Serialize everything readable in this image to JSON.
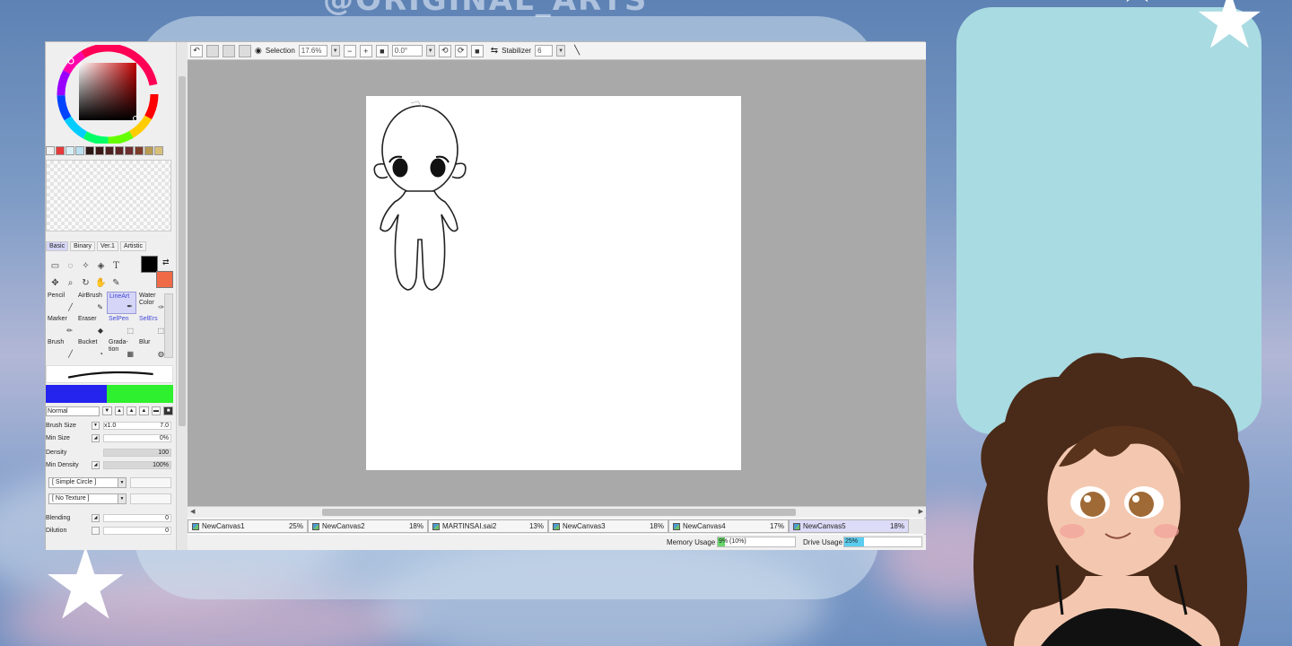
{
  "watermark": "@ORIGINAL_ARTS",
  "colors": {
    "fg": "#000000",
    "bg": "#ef6a47",
    "accent_tab": "#dcdcf8",
    "panel_cyan": "#a9dbe2",
    "memory_bar": "#69d66c",
    "drive_bar": "#5ccdf0"
  },
  "toolbar": {
    "undo_icon": "undo-icon",
    "selection_label": "Selection",
    "zoom_value": "17.6%",
    "rotation_value": "0.0°",
    "stabilizer_label": "Stabilizer",
    "stabilizer_value": "6"
  },
  "palette": [
    "#f2f2f2",
    "#e63939",
    "#d7f0f7",
    "#b9dff0",
    "#2b1616",
    "#3a1818",
    "#4a2020",
    "#5b2626",
    "#6d2f2f",
    "#7d3b2a",
    "#b89a52",
    "#d8c07a"
  ],
  "toolset_tabs": [
    "Basic",
    "Binary",
    "Ver.1",
    "Artistic"
  ],
  "brushes": [
    {
      "label": "Pencil",
      "active": false,
      "blue": false
    },
    {
      "label": "AirBrush",
      "active": false,
      "blue": false
    },
    {
      "label": "LineArt",
      "active": true,
      "blue": true
    },
    {
      "label": "Water Color",
      "active": false,
      "blue": false
    },
    {
      "label": "Marker",
      "active": false,
      "blue": false
    },
    {
      "label": "Eraser",
      "active": false,
      "blue": false
    },
    {
      "label": "SelPen",
      "active": false,
      "blue": true
    },
    {
      "label": "SelErs",
      "active": false,
      "blue": true
    },
    {
      "label": "Brush",
      "active": false,
      "blue": false
    },
    {
      "label": "Bucket",
      "active": false,
      "blue": false
    },
    {
      "label": "Grada-tion",
      "active": false,
      "blue": false
    },
    {
      "label": "Blur",
      "active": false,
      "blue": false
    }
  ],
  "brush_settings": {
    "mode": "Normal",
    "brush_size_label": "Brush Size",
    "brush_size_mult": "x1.0",
    "brush_size_value": "7.0",
    "min_size_label": "Min Size",
    "min_size_value": "0%",
    "density_label": "Density",
    "density_value": "100",
    "min_density_label": "Min Density",
    "min_density_value": "100%",
    "shape": "[ Simple Circle ]",
    "texture": "[ No Texture ]",
    "blending_label": "Blending",
    "blending_value": "0",
    "dilution_label": "Dilution",
    "dilution_value": "0"
  },
  "tabs": [
    {
      "name": "NewCanvas1",
      "zoom": "25%",
      "active": false
    },
    {
      "name": "NewCanvas2",
      "zoom": "18%",
      "active": false
    },
    {
      "name": "MARTINSAI.sai2",
      "zoom": "13%",
      "active": false
    },
    {
      "name": "NewCanvas3",
      "zoom": "18%",
      "active": false
    },
    {
      "name": "NewCanvas4",
      "zoom": "17%",
      "active": false
    },
    {
      "name": "NewCanvas5",
      "zoom": "18%",
      "active": true
    }
  ],
  "status": {
    "memory_label": "Memory Usage",
    "memory_value": "9% (10%)",
    "memory_fraction": 0.09,
    "drive_label": "Drive Usage",
    "drive_value": "25%",
    "drive_fraction": 0.25
  }
}
